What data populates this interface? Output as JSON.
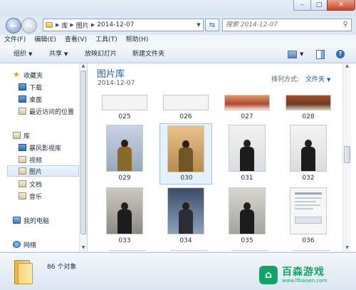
{
  "address": {
    "segments": [
      "库",
      "图片",
      "2014-12-07"
    ]
  },
  "search": {
    "placeholder": "搜索 2014-12-07"
  },
  "menu": [
    "文件(F)",
    "编辑(E)",
    "查看(V)",
    "工具(T)",
    "帮助(H)"
  ],
  "toolbar": {
    "organize": "组织",
    "share": "共享",
    "slideshow": "放映幻灯片",
    "new_folder": "新建文件夹"
  },
  "nav": {
    "favorites": "收藏夹",
    "downloads": "下载",
    "desktop": "桌面",
    "recent": "最近访问的位置",
    "libraries": "库",
    "storm": "暴风影视库",
    "videos": "视频",
    "pictures": "图片",
    "documents": "文档",
    "music": "音乐",
    "computer": "我的电脑",
    "network": "网络"
  },
  "content": {
    "header": "图片库",
    "subheader": "2014-12-07",
    "arrange_label": "排列方式:",
    "arrange_value": "文件夹",
    "items": [
      "025",
      "026",
      "027",
      "028",
      "029",
      "030",
      "031",
      "032",
      "033",
      "034",
      "035",
      "036"
    ]
  },
  "details": {
    "count": "86 个对象"
  },
  "watermark": {
    "title": "百森游戏",
    "url": "www.lfbaisen.com"
  },
  "icons": [
    "back-arrow-icon",
    "forward-arrow-icon",
    "folder-icon",
    "refresh-icon",
    "search-icon",
    "star-icon",
    "library-icon",
    "computer-icon",
    "network-icon"
  ]
}
